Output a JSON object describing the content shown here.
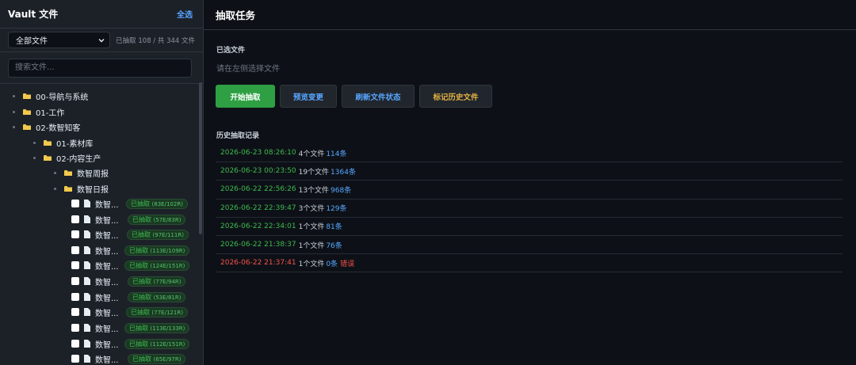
{
  "sidebar": {
    "title": "Vault 文件",
    "select_all": "全选",
    "filter": {
      "selected": "全部文件"
    },
    "count_text": "已抽取 108 / 共 344 文件",
    "search": {
      "placeholder": "搜索文件..."
    },
    "folders": [
      {
        "name": "00-导航与系统",
        "level": 0
      },
      {
        "name": "01-工作",
        "level": 0
      },
      {
        "name": "02-数智知客",
        "level": 0
      },
      {
        "name": "01-素材库",
        "level": 1
      },
      {
        "name": "02-内容生产",
        "level": 1
      },
      {
        "name": "数智周报",
        "level": 2
      },
      {
        "name": "数智日报",
        "level": 2
      }
    ],
    "files": [
      {
        "name": "数智...",
        "status": "已抽取",
        "detail": "(83E/102R)"
      },
      {
        "name": "数智...",
        "status": "已抽取",
        "detail": "(57E/83R)"
      },
      {
        "name": "数智...",
        "status": "已抽取",
        "detail": "(97E/111R)"
      },
      {
        "name": "数智...",
        "status": "已抽取",
        "detail": "(113E/109R)"
      },
      {
        "name": "数智...",
        "status": "已抽取",
        "detail": "(124E/151R)"
      },
      {
        "name": "数智...",
        "status": "已抽取",
        "detail": "(77E/94R)"
      },
      {
        "name": "数智...",
        "status": "已抽取",
        "detail": "(53E/81R)"
      },
      {
        "name": "数智...",
        "status": "已抽取",
        "detail": "(77E/121R)"
      },
      {
        "name": "数智...",
        "status": "已抽取",
        "detail": "(113E/133R)"
      },
      {
        "name": "数智...",
        "status": "已抽取",
        "detail": "(112E/151R)"
      },
      {
        "name": "数智...",
        "status": "已抽取",
        "detail": "(65E/97R)"
      }
    ]
  },
  "main": {
    "title": "抽取任务",
    "selected_label": "已选文件",
    "selected_placeholder": "请在左侧选择文件",
    "buttons": {
      "start": "开始抽取",
      "preview": "预览变更",
      "refresh": "刷新文件状态",
      "mark": "标记历史文件"
    },
    "history_label": "历史抽取记录",
    "history": [
      {
        "time": "2026-06-23 08:26:10",
        "files": "4个文件",
        "count": "114条",
        "error": ""
      },
      {
        "time": "2026-06-23 00:23:50",
        "files": "19个文件",
        "count": "1364条",
        "error": ""
      },
      {
        "time": "2026-06-22 22:56:26",
        "files": "13个文件",
        "count": "968条",
        "error": ""
      },
      {
        "time": "2026-06-22 22:39:47",
        "files": "3个文件",
        "count": "129条",
        "error": ""
      },
      {
        "time": "2026-06-22 22:34:01",
        "files": "1个文件",
        "count": "81条",
        "error": ""
      },
      {
        "time": "2026-06-22 21:38:37",
        "files": "1个文件",
        "count": "76条",
        "error": ""
      },
      {
        "time": "2026-06-22 21:37:41",
        "files": "1个文件",
        "count": "0条",
        "error": "错误"
      }
    ]
  },
  "colors": {
    "accent_blue": "#58a6ff",
    "success_green": "#3fb950",
    "primary_button": "#2ea043",
    "warning_yellow": "#e3b341",
    "error_red": "#f85149",
    "folder_yellow": "#f2c94c"
  },
  "icons": {
    "folder": "folder-icon",
    "file": "file-icon",
    "chevron": "chevron-down-icon",
    "bullet": "tree-bullet-icon"
  }
}
